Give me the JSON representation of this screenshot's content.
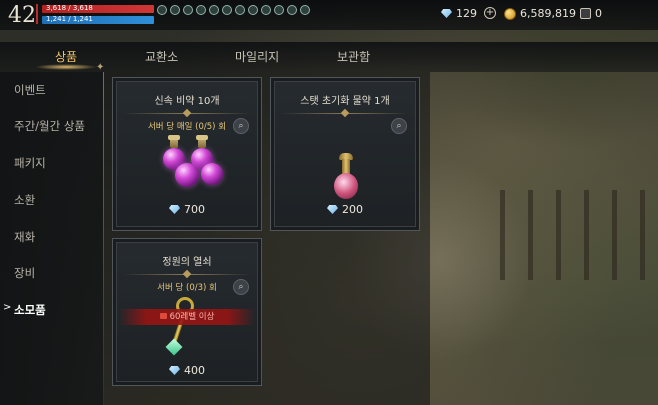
{
  "hud": {
    "level": "42",
    "hp_text": "3,618 / 3,618",
    "hp_fraction": 1.0,
    "mp_text": "1,241 / 1,241",
    "mp_fraction": 1.0,
    "buff_icons": [
      "buff-icon",
      "buff-icon",
      "buff-icon",
      "buff-icon",
      "buff-icon",
      "buff-icon",
      "buff-icon",
      "buff-icon",
      "buff-icon",
      "buff-icon",
      "buff-icon",
      "buff-icon"
    ]
  },
  "currencies": {
    "diamond": "129",
    "gold": "6,589,819",
    "mileage": "0"
  },
  "tabs": [
    {
      "label": "상품",
      "active": true
    },
    {
      "label": "교환소",
      "active": false
    },
    {
      "label": "마일리지",
      "active": false
    },
    {
      "label": "보관함",
      "active": false
    }
  ],
  "sidebar": {
    "items": [
      {
        "label": "이벤트"
      },
      {
        "label": "주간/월간 상품"
      },
      {
        "label": "패키지"
      },
      {
        "label": "소환"
      },
      {
        "label": "재화"
      },
      {
        "label": "장비"
      },
      {
        "label": "소모품",
        "active": true
      }
    ],
    "active_marker": ">"
  },
  "products": [
    {
      "title": "신속 비약 10개",
      "limit": "서버 당 매일 (0/5) 회",
      "price": "700"
    },
    {
      "title": "스탯 초기화 물약 1개",
      "price": "200"
    },
    {
      "title": "정원의 열쇠",
      "limit": "서버 당 (0/3) 회",
      "lock_text": "60레벨 이상",
      "price": "400"
    }
  ],
  "colors": {
    "active_tab": "#f2c46a",
    "limit_text": "#e8c77a",
    "lock_banner": "#961414",
    "hp": "#b32121",
    "mp": "#1f6fb5"
  }
}
